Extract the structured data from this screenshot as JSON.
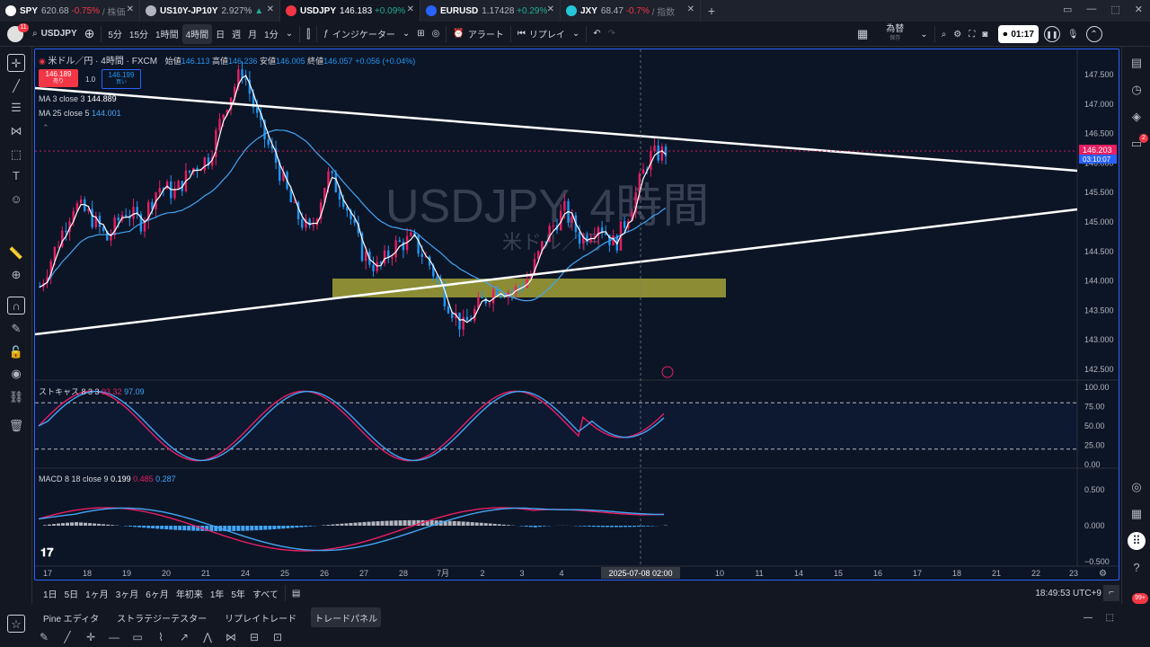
{
  "tabs": [
    {
      "sym": "SPY",
      "price": "620.68",
      "chg": "-0.75%",
      "extra": "/ 株価",
      "dir": "dn",
      "logo": "#ffffff"
    },
    {
      "sym": "US10Y-JP10Y",
      "price": "2.927%",
      "chg": "▲",
      "extra": "",
      "dir": "up",
      "logo": "#b2b5be"
    },
    {
      "sym": "USDJPY",
      "price": "146.183",
      "chg": "+0.09%",
      "extra": "",
      "dir": "up",
      "logo": "#f23645"
    },
    {
      "sym": "EURUSD",
      "price": "1.17428",
      "chg": "+0.29%",
      "extra": "",
      "dir": "up",
      "logo": "#2962ff"
    },
    {
      "sym": "JXY",
      "price": "68.47",
      "chg": "-0.7%",
      "extra": "/ 指数",
      "dir": "dn",
      "logo": "#26c6da"
    }
  ],
  "toolbar": {
    "symbol": "USDJPY",
    "intervals": [
      "5分",
      "15分",
      "1時間",
      "4時間",
      "日",
      "週",
      "月",
      "1分"
    ],
    "selected_interval": "4時間",
    "indicators": "インジケーター",
    "alert": "アラート",
    "replay": "リプレイ",
    "fx": "為替",
    "fx_sub": "保存",
    "timer": "01:17",
    "badge": "11"
  },
  "chart": {
    "title": "米ドル／円 · 4時間 · FXCM",
    "ohlc": {
      "o_label": "始値",
      "o": "146.113",
      "h_label": "高値",
      "h": "146.236",
      "l_label": "安値",
      "l": "146.005",
      "c_label": "終値",
      "c": "146.057",
      "chg": "+0.056 (+0.04%)"
    },
    "sell": "146.189",
    "sell_label": "売り",
    "spread": "1.0",
    "buy": "146.199",
    "buy_label": "買い",
    "ma1": {
      "label": "MA 3 close 3",
      "value": "144.889"
    },
    "ma2": {
      "label": "MA 25 close 5",
      "value": "144.001"
    },
    "watermark_symbol": "USDJPY, 4時間",
    "watermark_desc": "米ドル／円",
    "price_ticks": [
      "147.500",
      "147.000",
      "146.500",
      "146.000",
      "145.500",
      "145.000",
      "144.500",
      "144.000",
      "143.500",
      "143.000",
      "142.500"
    ],
    "last_price": "146.203",
    "countdown": "03:10:07",
    "stoch": {
      "label": "ストキャス 8 3 3",
      "v1": "93.32",
      "v2": "97.09",
      "ticks": [
        "100.00",
        "75.00",
        "50.00",
        "25.00",
        "0.00"
      ]
    },
    "macd": {
      "label": "MACD 8 18 close 9",
      "v1": "0.199",
      "v2": "0.485",
      "v3": "0.287",
      "ticks": [
        "0.500",
        "0.000",
        "−0.500"
      ]
    },
    "time_ticks": [
      "17",
      "18",
      "19",
      "20",
      "21",
      "24",
      "25",
      "26",
      "27",
      "28",
      "7月",
      "2",
      "3",
      "4",
      "9",
      "10",
      "11",
      "14",
      "15",
      "16",
      "17",
      "18",
      "21",
      "22",
      "23"
    ],
    "crosshair_time": "2025-07-08 02:00"
  },
  "bottom": {
    "ranges": [
      "1日",
      "5日",
      "1ヶ月",
      "3ヶ月",
      "6ヶ月",
      "年初来",
      "1年",
      "5年",
      "すべて"
    ],
    "clock": "18:49:53 UTC+9"
  },
  "panels": [
    "Pine エディタ",
    "ストラテジーテスター",
    "リプレイトレード",
    "トレードパネル"
  ],
  "notif_badge": "99+",
  "right_badge": "2"
}
